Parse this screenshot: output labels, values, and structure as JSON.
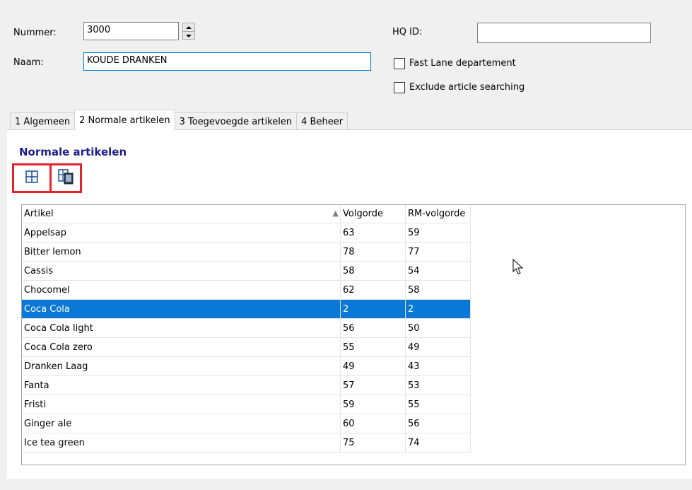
{
  "form": {
    "nummer_label": "Nummer:",
    "nummer_value": "3000",
    "naam_label": "Naam:",
    "naam_value": "KOUDE DRANKEN",
    "hqid_label": "HQ ID:",
    "hqid_value": "",
    "fastlane_label": "Fast Lane departement",
    "exclude_label": "Exclude article searching"
  },
  "tabs": [
    {
      "label": "1 Algemeen"
    },
    {
      "label": "2 Normale artikelen"
    },
    {
      "label": "3 Toegevoegde artikelen"
    },
    {
      "label": "4 Beheer"
    }
  ],
  "panel": {
    "title": "Normale artikelen",
    "add_icon": "grid-add-icon",
    "edit_icon": "grid-edit-icon"
  },
  "grid": {
    "columns": [
      "Artikel",
      "Volgorde",
      "RM-volgorde"
    ],
    "rows": [
      {
        "artikel": "Appelsap",
        "volgorde": "63",
        "rm": "59"
      },
      {
        "artikel": "Bitter lemon",
        "volgorde": "78",
        "rm": "77"
      },
      {
        "artikel": "Cassis",
        "volgorde": "58",
        "rm": "54"
      },
      {
        "artikel": "Chocomel",
        "volgorde": "62",
        "rm": "58"
      },
      {
        "artikel": "Coca Cola",
        "volgorde": "2",
        "rm": "2"
      },
      {
        "artikel": "Coca Cola light",
        "volgorde": "56",
        "rm": "50"
      },
      {
        "artikel": "Coca Cola zero",
        "volgorde": "55",
        "rm": "49"
      },
      {
        "artikel": "Dranken Laag",
        "volgorde": "49",
        "rm": "43"
      },
      {
        "artikel": "Fanta",
        "volgorde": "57",
        "rm": "53"
      },
      {
        "artikel": "Fristi",
        "volgorde": "59",
        "rm": "55"
      },
      {
        "artikel": "Ginger ale",
        "volgorde": "60",
        "rm": "56"
      },
      {
        "artikel": "Ice tea green",
        "volgorde": "75",
        "rm": "74"
      }
    ]
  },
  "colors": {
    "selection": "#0a78d7",
    "title": "#1f1f8c",
    "highlight_box": "#e8202a"
  }
}
